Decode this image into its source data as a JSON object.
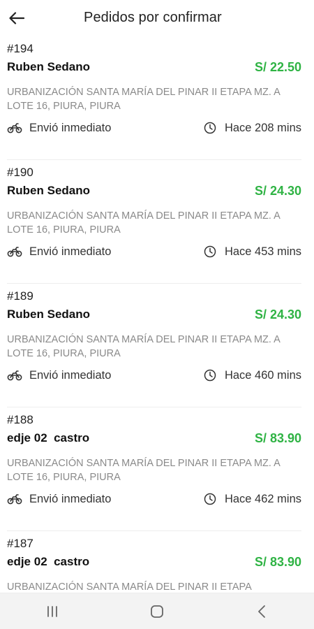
{
  "header": {
    "title": "Pedidos por confirmar",
    "back_icon": "arrow-left-icon"
  },
  "orders": [
    {
      "id": "#194",
      "customer": "Ruben Sedano",
      "price": "S/ 22.50",
      "address": "URBANIZACIÓN SANTA MARÍA DEL PINAR II ETAPA MZ. A LOTE 16, PIURA, PIURA",
      "delivery": "Envió inmediato",
      "time": "Hace 208 mins"
    },
    {
      "id": "#190",
      "customer": "Ruben Sedano",
      "price": "S/ 24.30",
      "address": "URBANIZACIÓN SANTA MARÍA DEL PINAR II ETAPA MZ. A LOTE 16, PIURA, PIURA",
      "delivery": "Envió inmediato",
      "time": "Hace 453 mins"
    },
    {
      "id": "#189",
      "customer": "Ruben Sedano",
      "price": "S/ 24.30",
      "address": "URBANIZACIÓN SANTA MARÍA DEL PINAR II ETAPA MZ. A LOTE 16, PIURA, PIURA",
      "delivery": "Envió inmediato",
      "time": "Hace 460 mins"
    },
    {
      "id": "#188",
      "customer": "edje 02  castro",
      "price": "S/ 83.90",
      "address": "URBANIZACIÓN SANTA MARÍA DEL PINAR II ETAPA MZ. A LOTE 16, PIURA, PIURA",
      "delivery": "Envió inmediato",
      "time": "Hace 462 mins"
    },
    {
      "id": "#187",
      "customer": "edje 02  castro",
      "price": "S/ 83.90",
      "address": "URBANIZACIÓN SANTA MARÍA DEL PINAR II ETAPA",
      "delivery": "",
      "time": ""
    }
  ],
  "colors": {
    "price_green": "#2fb344",
    "address_gray": "#8a8a8a"
  },
  "navbar": {
    "recents_icon": "recents-icon",
    "home_icon": "home-icon",
    "back_icon": "nav-back-icon"
  }
}
